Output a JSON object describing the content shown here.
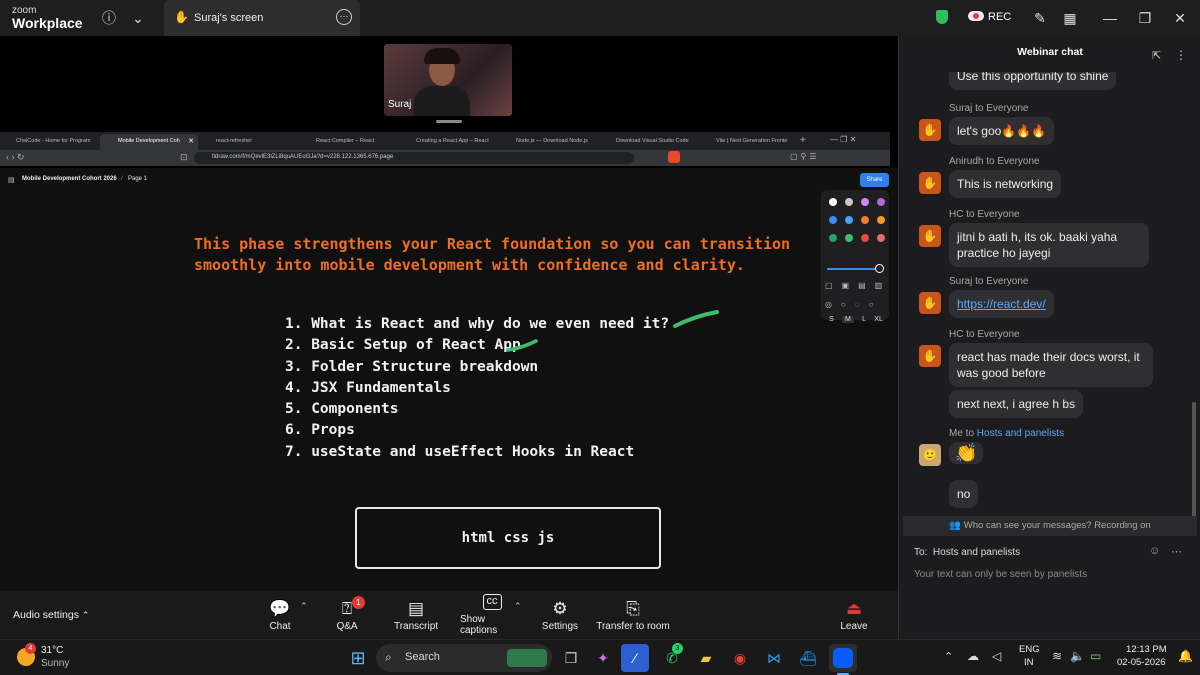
{
  "zoom": {
    "brand_small": "zoom",
    "brand_large": "Workplace",
    "share_tab_title": "Suraj's screen",
    "rec_label": "REC",
    "presenter_name": "Suraj"
  },
  "browser": {
    "tabs": [
      "ChaiCode - Home for Program",
      "Mobile Development Coh",
      "react-refresher",
      "React Compiler – React",
      "Creating a React App – React",
      "Node.js — Download Node.js",
      "Download Visual Studio Code",
      "Vite | Next Generation Fronte"
    ],
    "url": "tldraw.com/f/mQevlE3lZLi8quAUEoGJa?d=v228.122.1365.676.page"
  },
  "tldraw": {
    "doc_title": "Mobile Development Cohort 2026",
    "page_label": "Page 1",
    "share_label": "Share",
    "sizes": [
      "S",
      "M",
      "L",
      "XL"
    ],
    "intro": "This phase strengthens your React foundation so you can transition smoothly into mobile development with confidence and clarity.",
    "topics": [
      "1. What is React and why do we even need it?",
      "2. Basic Setup of React App",
      "3. Folder Structure breakdown",
      "4. JSX Fundamentals",
      "5. Components",
      "6. Props",
      "7. useState and useEffect Hooks in React"
    ],
    "box_text": "html css js",
    "palette": [
      "#ffffff",
      "#c9c9c9",
      "#d286f5",
      "#b06ad8",
      "#3c8bf5",
      "#4ba1f7",
      "#f07d2e",
      "#f59b2c",
      "#2c9b6e",
      "#3fbd6e",
      "#e64848",
      "#e86a6a"
    ],
    "accent_orange": "#f26d21",
    "accent_green": "#3fbd6e"
  },
  "controls": {
    "audio_settings": "Audio settings",
    "chat": "Chat",
    "qa": "Q&A",
    "qa_badge": "1",
    "transcript": "Transcript",
    "show_captions": "Show captions",
    "settings": "Settings",
    "transfer": "Transfer to room",
    "leave": "Leave"
  },
  "chat": {
    "title": "Webinar chat",
    "partial_top": "Use this opportunity to shine",
    "messages": [
      {
        "sender": "Suraj to Everyone",
        "text": "let's goo🔥🔥🔥"
      },
      {
        "sender": "Anirudh to Everyone",
        "text": "This is networking"
      },
      {
        "sender": "HC to Everyone",
        "text": "jitni b aati h, its ok. baaki yaha practice ho jayegi"
      },
      {
        "sender": "Suraj to Everyone",
        "text": "https://react.dev/"
      },
      {
        "sender": "HC to Everyone",
        "text": "react has made their docs worst, it was good before",
        "extra": "next next, i agree h bs"
      }
    ],
    "me_sender": "Me to",
    "me_target": "Hosts and panelists",
    "me_emoji": "👏",
    "me_text": "no",
    "privacy_note": "Who can see your messages? Recording on",
    "to_label": "To:",
    "to_value": "Hosts and panelists",
    "input_placeholder": "Your text can only be seen by panelists"
  },
  "taskbar": {
    "temp": "31°C",
    "weather": "Sunny",
    "weather_badge": "4",
    "search": "Search",
    "whatsapp_badge": "3",
    "lang1": "ENG",
    "lang2": "IN",
    "time": "12:13 PM",
    "date": "02-05-2026"
  }
}
